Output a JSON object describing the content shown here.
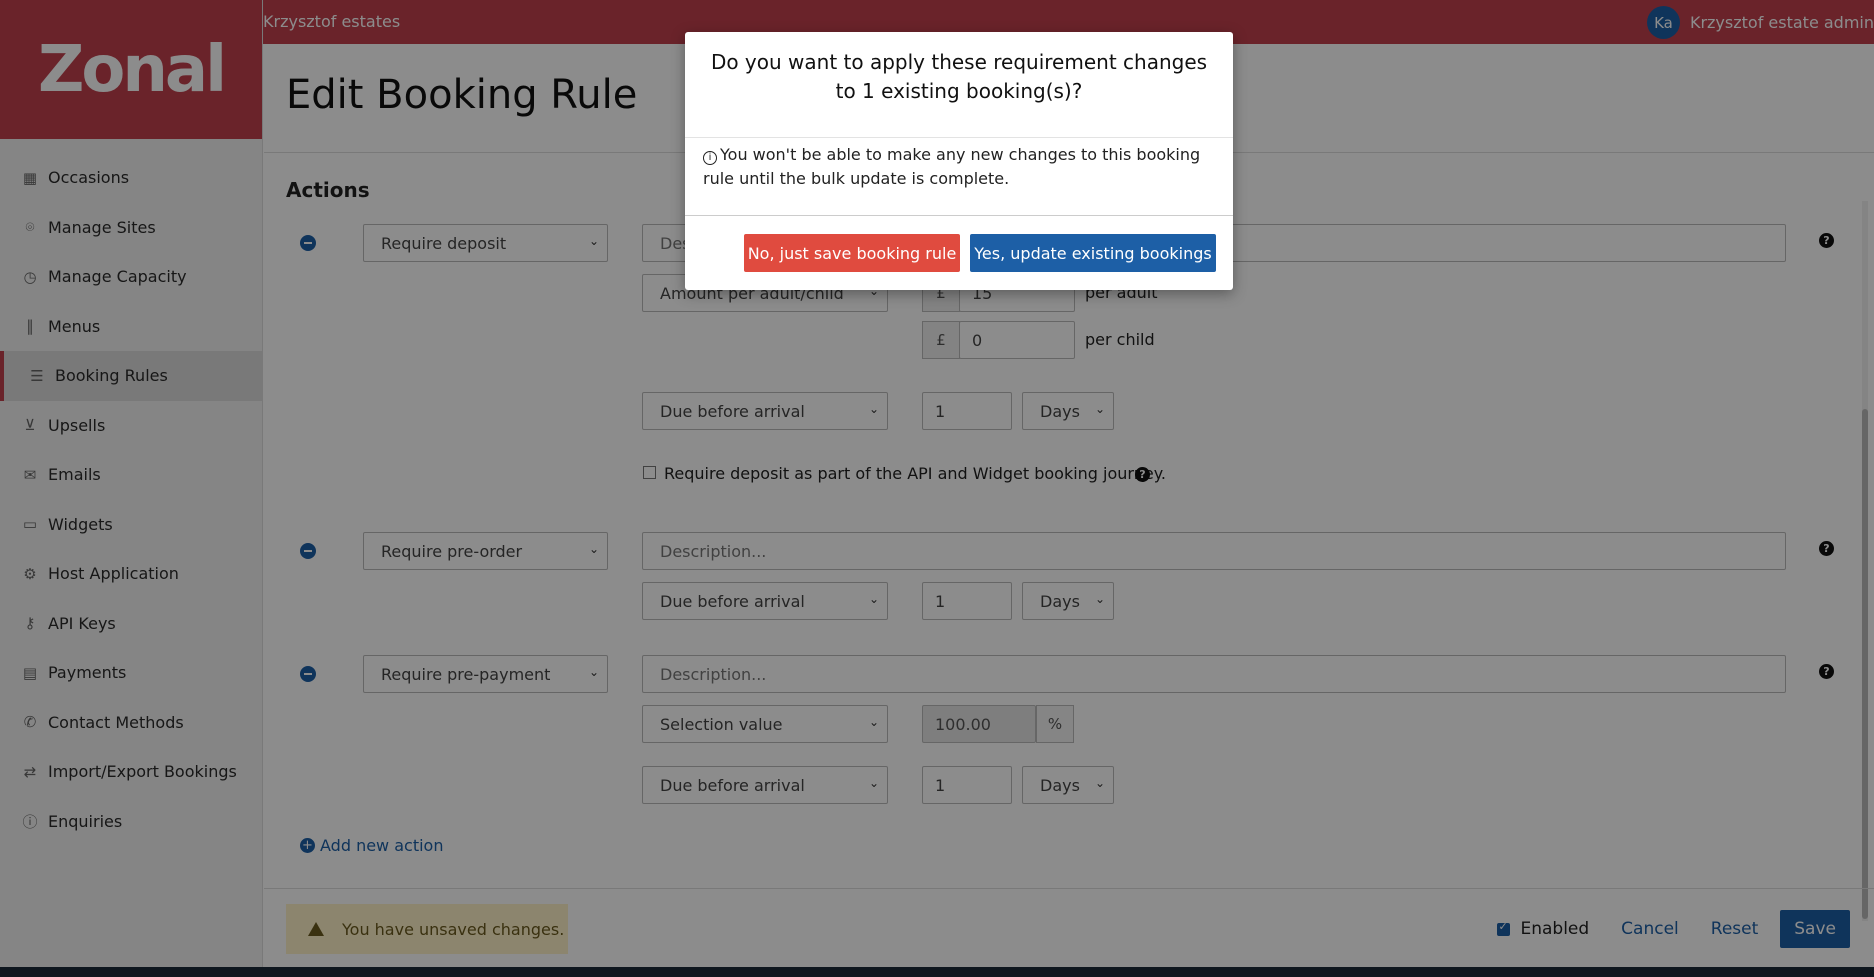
{
  "topbar": {
    "org_name": "Krzysztof estates",
    "user_initials": "Ka",
    "user_name": "Krzysztof estate admin"
  },
  "logo": {
    "text": "Zonal"
  },
  "sidebar": {
    "items": [
      {
        "label": "Occasions",
        "icon": "calendar-icon"
      },
      {
        "label": "Manage Sites",
        "icon": "map-pin-icon"
      },
      {
        "label": "Manage Capacity",
        "icon": "clock-icon"
      },
      {
        "label": "Menus",
        "icon": "cutlery-icon"
      },
      {
        "label": "Booking Rules",
        "icon": "list-icon",
        "active": true
      },
      {
        "label": "Upsells",
        "icon": "cart-icon"
      },
      {
        "label": "Emails",
        "icon": "envelope-icon"
      },
      {
        "label": "Widgets",
        "icon": "window-icon"
      },
      {
        "label": "Host Application",
        "icon": "gears-icon"
      },
      {
        "label": "API Keys",
        "icon": "key-icon"
      },
      {
        "label": "Payments",
        "icon": "credit-card-icon"
      },
      {
        "label": "Contact Methods",
        "icon": "phone-icon"
      },
      {
        "label": "Import/Export Bookings",
        "icon": "user-exchange-icon"
      },
      {
        "label": "Enquiries",
        "icon": "info-icon"
      }
    ]
  },
  "page": {
    "title": "Edit Booking Rule",
    "section_title": "Actions"
  },
  "actions": {
    "deposit": {
      "type": "Require deposit",
      "description_placeholder": "Description...",
      "amount_mode": "Amount per adult/child",
      "currency": "£",
      "adult_amount": "15",
      "adult_label": "per adult",
      "child_amount": "0",
      "child_label": "per child",
      "due": "Due before arrival",
      "due_value": "1",
      "due_unit": "Days",
      "api_checkbox_label": "Require deposit as part of the API and Widget booking journey."
    },
    "preorder": {
      "type": "Require pre-order",
      "description_placeholder": "Description...",
      "due": "Due before arrival",
      "due_value": "1",
      "due_unit": "Days"
    },
    "prepayment": {
      "type": "Require pre-payment",
      "description_placeholder": "Description...",
      "selection": "Selection value",
      "percent_value": "100.00",
      "percent_symbol": "%",
      "due": "Due before arrival",
      "due_value": "1",
      "due_unit": "Days"
    },
    "add_label": "Add new action"
  },
  "footer": {
    "unsaved_text": "You have unsaved changes.",
    "enabled_label": "Enabled",
    "cancel_label": "Cancel",
    "reset_label": "Reset",
    "save_label": "Save"
  },
  "modal": {
    "title": "Do you want to apply these requirement changes to 1 existing booking(s)?",
    "info_glyph": "i",
    "body": "You won't be able to make any new changes to this booking rule until the bulk update is complete.",
    "no_label": "No, just save booking rule",
    "yes_label": "Yes, update existing bookings"
  },
  "colors": {
    "brand": "#c1414e",
    "primary": "#1d5fa6",
    "danger": "#e04b3f"
  }
}
